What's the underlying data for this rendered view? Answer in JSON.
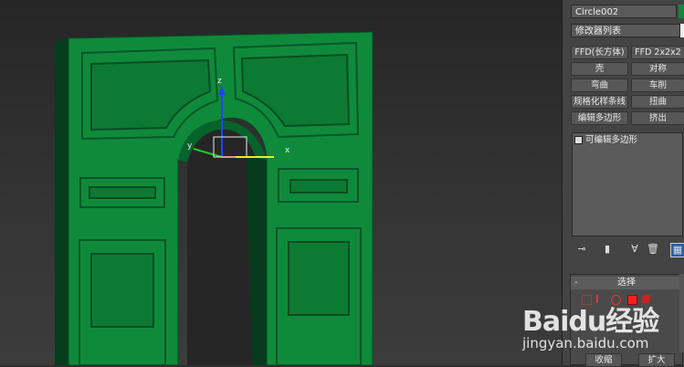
{
  "panel": {
    "object_name": "Circle002",
    "modifier_list": "修改器列表",
    "buttons": [
      {
        "label": "FFD(长方体)"
      },
      {
        "label": "FFD 2x2x2"
      },
      {
        "label": "壳"
      },
      {
        "label": "对称"
      },
      {
        "label": "弯曲"
      },
      {
        "label": "车削"
      },
      {
        "label": "规格化样条线"
      },
      {
        "label": "扭曲"
      },
      {
        "label": "编辑多边形"
      },
      {
        "label": "挤出"
      }
    ],
    "stack_item": "可编辑多边形",
    "selection_title": "选择",
    "bottom_buttons": [
      "收缩",
      "扩大"
    ]
  },
  "viewport": {
    "axis_x": "x",
    "axis_y": "y"
  },
  "colors": {
    "door_green": "#0f8a3a",
    "door_dark": "#06572a",
    "gizmo_x": "#e33",
    "gizmo_y": "#2c2",
    "gizmo_z": "#24f"
  },
  "watermark": {
    "brand": "Baidu经验",
    "url": "jingyan.baidu.com"
  }
}
